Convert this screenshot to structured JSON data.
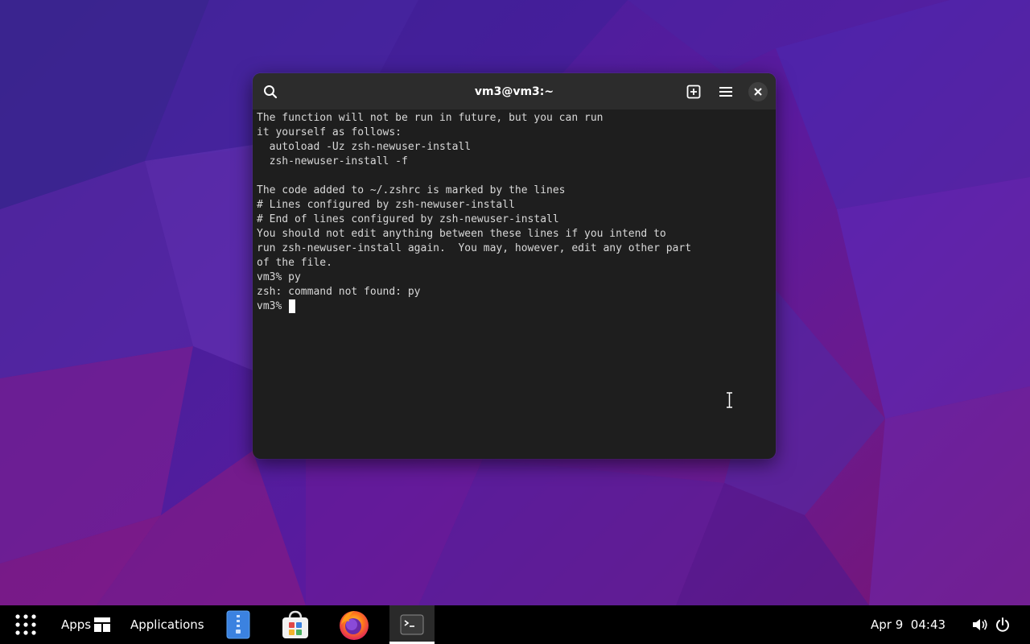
{
  "terminal": {
    "title": "vm3@vm3:~",
    "lines": [
      "The function will not be run in future, but you can run",
      "it yourself as follows:",
      "  autoload -Uz zsh-newuser-install",
      "  zsh-newuser-install -f",
      "",
      "The code added to ~/.zshrc is marked by the lines",
      "# Lines configured by zsh-newuser-install",
      "# End of lines configured by zsh-newuser-install",
      "You should not edit anything between these lines if you intend to",
      "run zsh-newuser-install again.  You may, however, edit any other part",
      "of the file.",
      "vm3% py",
      "zsh: command not found: py"
    ],
    "prompt": "vm3% ",
    "icons": {
      "search": "search-icon",
      "new_tab": "new-tab-icon",
      "menu": "hamburger-menu-icon",
      "close": "close-icon"
    }
  },
  "taskbar": {
    "apps_label": "Apps",
    "applications_label": "Applications",
    "clock": "Apr 9  04:43",
    "pinned": [
      {
        "name": "files",
        "icon": "file-manager-icon"
      },
      {
        "name": "software-store",
        "icon": "store-bag-icon"
      },
      {
        "name": "firefox",
        "icon": "firefox-icon"
      },
      {
        "name": "terminal",
        "icon": "terminal-icon",
        "active": true
      }
    ]
  },
  "colors": {
    "taskbar_bg": "#000000",
    "terminal_bg": "#1e1e1e",
    "titlebar_bg": "#2c2c2c",
    "terminal_text": "#d8d8d8"
  }
}
